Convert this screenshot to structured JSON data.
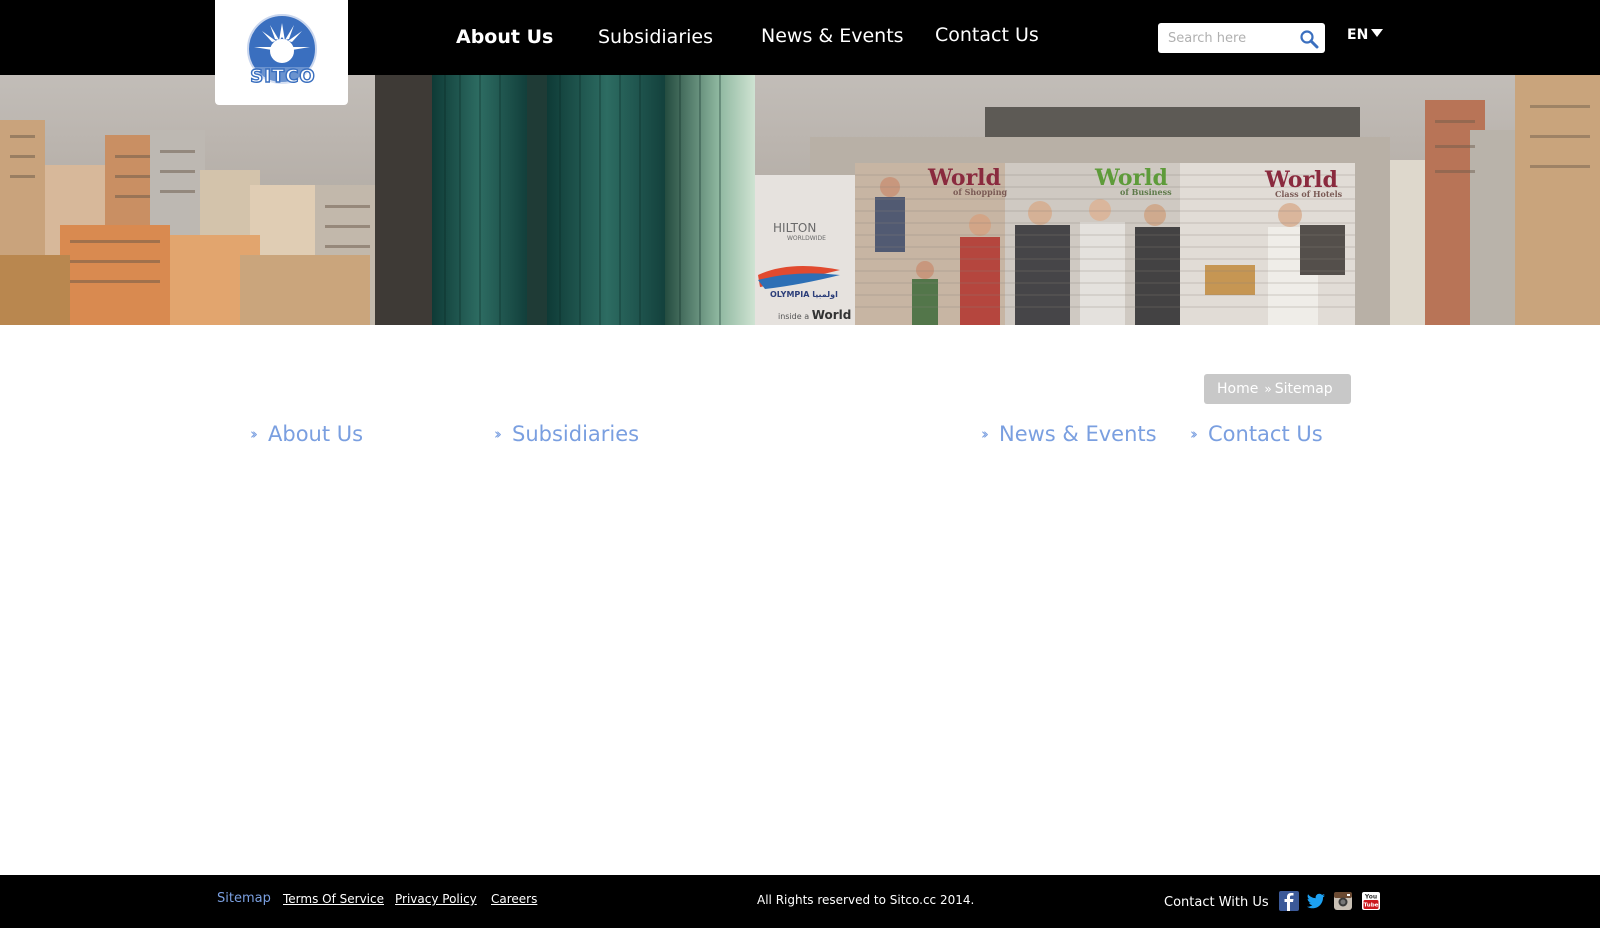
{
  "brand": {
    "logo_text": "SITCO",
    "accent": "#7a9fe0",
    "logo_blue": "#3a6fbf"
  },
  "nav": {
    "items": [
      {
        "label": "About Us",
        "active": true
      },
      {
        "label": "Subsidiaries",
        "active": false
      },
      {
        "label": "News & Events",
        "active": false
      },
      {
        "label": "Contact Us",
        "active": false
      }
    ]
  },
  "search": {
    "placeholder": "Search here",
    "icon": "magnifier-icon"
  },
  "language": {
    "selected": "EN"
  },
  "hero": {
    "billboard": {
      "world_1": "World",
      "world_1_sub": "of Shopping",
      "world_2": "World",
      "world_2_sub": "of Business",
      "world_3": "World",
      "world_3_sub": "Class of Hotels",
      "hilton": "HILTON",
      "hilton_sub": "WORLDWIDE",
      "olympia": "OLYMPIA اولمبيا",
      "inside": "inside a",
      "inside_world": "World"
    }
  },
  "breadcrumb": {
    "home": "Home",
    "current": "Sitemap"
  },
  "sitemap": {
    "columns": [
      "About Us",
      "Subsidiaries",
      "News & Events",
      "Contact Us"
    ]
  },
  "footer": {
    "links": [
      "Sitemap",
      "Terms Of Service",
      "Privacy Policy",
      "Careers"
    ],
    "copyright": "All Rights reserved to Sitco.cc 2014.",
    "contact_label": "Contact  With Us",
    "social": [
      "facebook-icon",
      "twitter-icon",
      "instagram-icon",
      "youtube-icon"
    ],
    "colors": {
      "facebook": "#3b5998",
      "twitter": "#1da1f2",
      "youtube": "#cc181e"
    }
  }
}
